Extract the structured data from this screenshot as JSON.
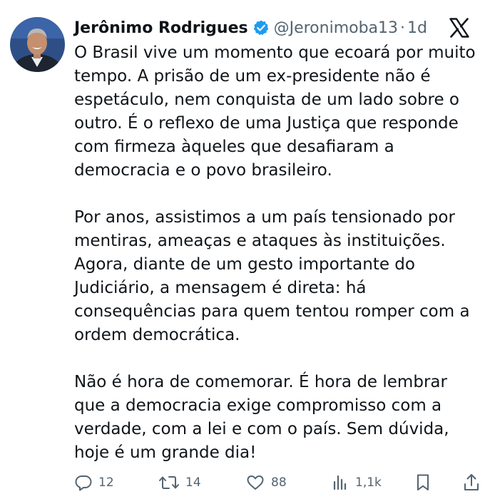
{
  "author": {
    "display_name": "Jerônimo Rodrigues",
    "handle": "@Jeronimoba13",
    "separator": "·",
    "time": "1d",
    "verified": true,
    "avatar_icon": "profile-photo"
  },
  "platform": {
    "logo_icon": "x-logo"
  },
  "tweet": {
    "paragraphs": [
      "O Brasil vive um momento que ecoará por muito tempo. A prisão de um ex-presidente não é espetáculo, nem conquista de um lado sobre o outro. É o reflexo de uma Justiça que responde com firmeza àqueles que desafiaram a democracia e o povo brasileiro.",
      "Por anos, assistimos a um país tensionado por mentiras, ameaças e ataques às instituições. Agora, diante de um gesto importante do Judiciário, a mensagem é direta: há consequências para quem tentou romper com a ordem democrática.",
      "Não é hora de comemorar. É hora de lembrar que a democracia exige compromisso com a verdade, com a lei e com o país. Sem dúvida, hoje é um grande dia!"
    ]
  },
  "actions": {
    "replies": "12",
    "reposts": "14",
    "likes": "88",
    "views": "1,1k"
  },
  "colors": {
    "text": "#0f1419",
    "secondary": "#536471",
    "verified": "#1d9bf0"
  }
}
